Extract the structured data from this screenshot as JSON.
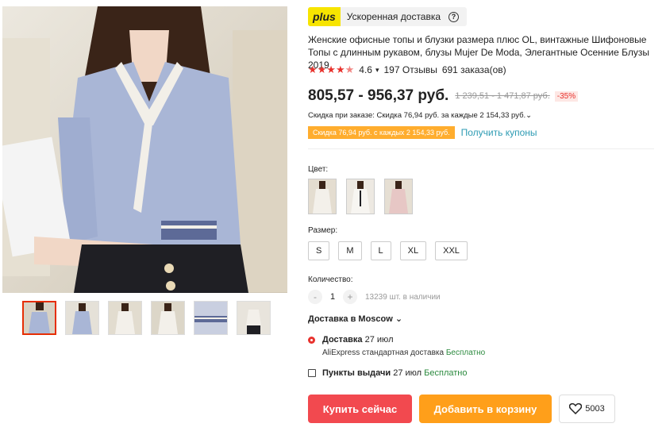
{
  "plus": {
    "badge": "plus",
    "text": "Ускоренная доставка",
    "help": "?"
  },
  "product": {
    "title": "Женские офисные топы и блузки размера плюс OL, винтажные Шифоновые Топы с длинным рукавом, блузы Mujer De Moda, Элегантные Осенние Блузы 2019",
    "stars": "★★★★",
    "star_half": "★",
    "rating": "4.6",
    "chevron": "▾",
    "reviews": "197 Отзывы",
    "orders": "691 заказа(ов)"
  },
  "price": {
    "current": "805,57 - 956,37 руб.",
    "old": "1 239,51 - 1 471,87 руб.",
    "discount": "-35%",
    "order_discount": "Скидка при заказе: Скидка 76,94 руб. за каждые 2 154,33 руб.⌄",
    "coupon": "Скидка 76,94 руб. с каждых 2 154,33 руб.",
    "coupon_link": "Получить купоны"
  },
  "options": {
    "color_label": "Цвет:",
    "size_label": "Размер:",
    "sizes": [
      "S",
      "M",
      "L",
      "XL",
      "XXL"
    ],
    "qty_label": "Количество:",
    "qty_minus": "-",
    "qty_value": "1",
    "qty_plus": "+",
    "stock": "13239 шт. в наличии"
  },
  "shipping": {
    "destination": "Доставка в Moscow ⌄",
    "delivery_title": "Доставка",
    "delivery_date": "27 июл",
    "method": "AliExpress стандартная доставка",
    "free": "Бесплатно",
    "pickup_title": "Пункты выдачи",
    "pickup_date": "27 июл",
    "pickup_free": "Бесплатно"
  },
  "actions": {
    "buy": "Купить сейчас",
    "cart": "Добавить в корзину",
    "wishlist_count": "5003"
  },
  "colors": {
    "accent_red": "#e8322d",
    "buy_button": "#f2494f",
    "cart_button": "#ff9f1a",
    "plus_yellow": "#f7e400",
    "free_green": "#2b8a3e"
  }
}
